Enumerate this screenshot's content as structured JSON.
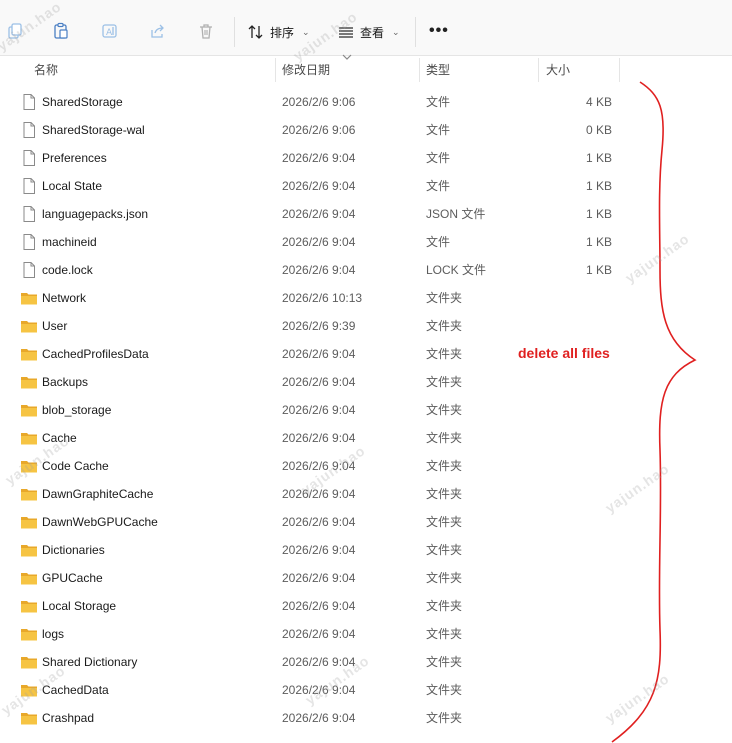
{
  "toolbar": {
    "sort_label": "排序",
    "view_label": "查看",
    "more_label": "•••"
  },
  "columns": {
    "name": "名称",
    "date": "修改日期",
    "type": "类型",
    "size": "大小"
  },
  "files": [
    {
      "name": "SharedStorage",
      "date": "2026/2/6 9:06",
      "type": "文件",
      "size": "4 KB",
      "kind": "file"
    },
    {
      "name": "SharedStorage-wal",
      "date": "2026/2/6 9:06",
      "type": "文件",
      "size": "0 KB",
      "kind": "file"
    },
    {
      "name": "Preferences",
      "date": "2026/2/6 9:04",
      "type": "文件",
      "size": "1 KB",
      "kind": "file"
    },
    {
      "name": "Local State",
      "date": "2026/2/6 9:04",
      "type": "文件",
      "size": "1 KB",
      "kind": "file"
    },
    {
      "name": "languagepacks.json",
      "date": "2026/2/6 9:04",
      "type": "JSON 文件",
      "size": "1 KB",
      "kind": "file"
    },
    {
      "name": "machineid",
      "date": "2026/2/6 9:04",
      "type": "文件",
      "size": "1 KB",
      "kind": "file"
    },
    {
      "name": "code.lock",
      "date": "2026/2/6 9:04",
      "type": "LOCK 文件",
      "size": "1 KB",
      "kind": "file"
    },
    {
      "name": "Network",
      "date": "2026/2/6 10:13",
      "type": "文件夹",
      "size": "",
      "kind": "folder"
    },
    {
      "name": "User",
      "date": "2026/2/6 9:39",
      "type": "文件夹",
      "size": "",
      "kind": "folder"
    },
    {
      "name": "CachedProfilesData",
      "date": "2026/2/6 9:04",
      "type": "文件夹",
      "size": "",
      "kind": "folder"
    },
    {
      "name": "Backups",
      "date": "2026/2/6 9:04",
      "type": "文件夹",
      "size": "",
      "kind": "folder"
    },
    {
      "name": "blob_storage",
      "date": "2026/2/6 9:04",
      "type": "文件夹",
      "size": "",
      "kind": "folder"
    },
    {
      "name": "Cache",
      "date": "2026/2/6 9:04",
      "type": "文件夹",
      "size": "",
      "kind": "folder"
    },
    {
      "name": "Code Cache",
      "date": "2026/2/6 9:04",
      "type": "文件夹",
      "size": "",
      "kind": "folder"
    },
    {
      "name": "DawnGraphiteCache",
      "date": "2026/2/6 9:04",
      "type": "文件夹",
      "size": "",
      "kind": "folder"
    },
    {
      "name": "DawnWebGPUCache",
      "date": "2026/2/6 9:04",
      "type": "文件夹",
      "size": "",
      "kind": "folder"
    },
    {
      "name": "Dictionaries",
      "date": "2026/2/6 9:04",
      "type": "文件夹",
      "size": "",
      "kind": "folder"
    },
    {
      "name": "GPUCache",
      "date": "2026/2/6 9:04",
      "type": "文件夹",
      "size": "",
      "kind": "folder"
    },
    {
      "name": "Local Storage",
      "date": "2026/2/6 9:04",
      "type": "文件夹",
      "size": "",
      "kind": "folder"
    },
    {
      "name": "logs",
      "date": "2026/2/6 9:04",
      "type": "文件夹",
      "size": "",
      "kind": "folder"
    },
    {
      "name": "Shared Dictionary",
      "date": "2026/2/6 9:04",
      "type": "文件夹",
      "size": "",
      "kind": "folder"
    },
    {
      "name": "CachedData",
      "date": "2026/2/6 9:04",
      "type": "文件夹",
      "size": "",
      "kind": "folder"
    },
    {
      "name": "Crashpad",
      "date": "2026/2/6 9:04",
      "type": "文件夹",
      "size": "",
      "kind": "folder"
    }
  ],
  "annotation": {
    "text": "delete all files",
    "color": "#e02020"
  },
  "watermark": "yajun.hao",
  "colors": {
    "folder": "#f6c443",
    "folder_dark": "#e8a82a",
    "annotation": "#e02020"
  }
}
